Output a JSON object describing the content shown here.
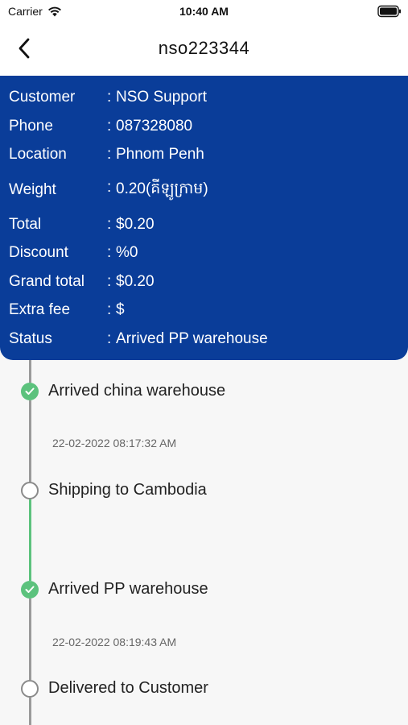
{
  "status_bar": {
    "carrier": "Carrier",
    "time": "10:40 AM"
  },
  "header": {
    "title": "nso223344"
  },
  "info": {
    "colon": ":",
    "rows": [
      {
        "label": "Customer",
        "value": "NSO Support"
      },
      {
        "label": "Phone",
        "value": "087328080"
      },
      {
        "label": "Location",
        "value": "Phnom Penh"
      },
      {
        "label": "Weight",
        "value": "0.20(គីឡូក្រាម)"
      },
      {
        "label": "Total",
        "value": "$0.20"
      },
      {
        "label": "Discount",
        "value": "%0"
      },
      {
        "label": "Grand total",
        "value": "$0.20"
      },
      {
        "label": "Extra fee",
        "value": "$"
      },
      {
        "label": "Status",
        "value": "Arrived PP warehouse"
      }
    ]
  },
  "timeline": [
    {
      "title": "Arrived china warehouse",
      "time": "22-02-2022 08:17:32 AM",
      "done": true
    },
    {
      "title": "Shipping to Cambodia",
      "time": "",
      "done": false
    },
    {
      "title": "Arrived PP warehouse",
      "time": "22-02-2022 08:19:43 AM",
      "done": true
    },
    {
      "title": "Delivered to Customer",
      "time": "",
      "done": false
    }
  ],
  "colors": {
    "header_blue": "#0a3d99",
    "done_green": "#5cc27d",
    "line_gray": "#9a9a9a"
  }
}
